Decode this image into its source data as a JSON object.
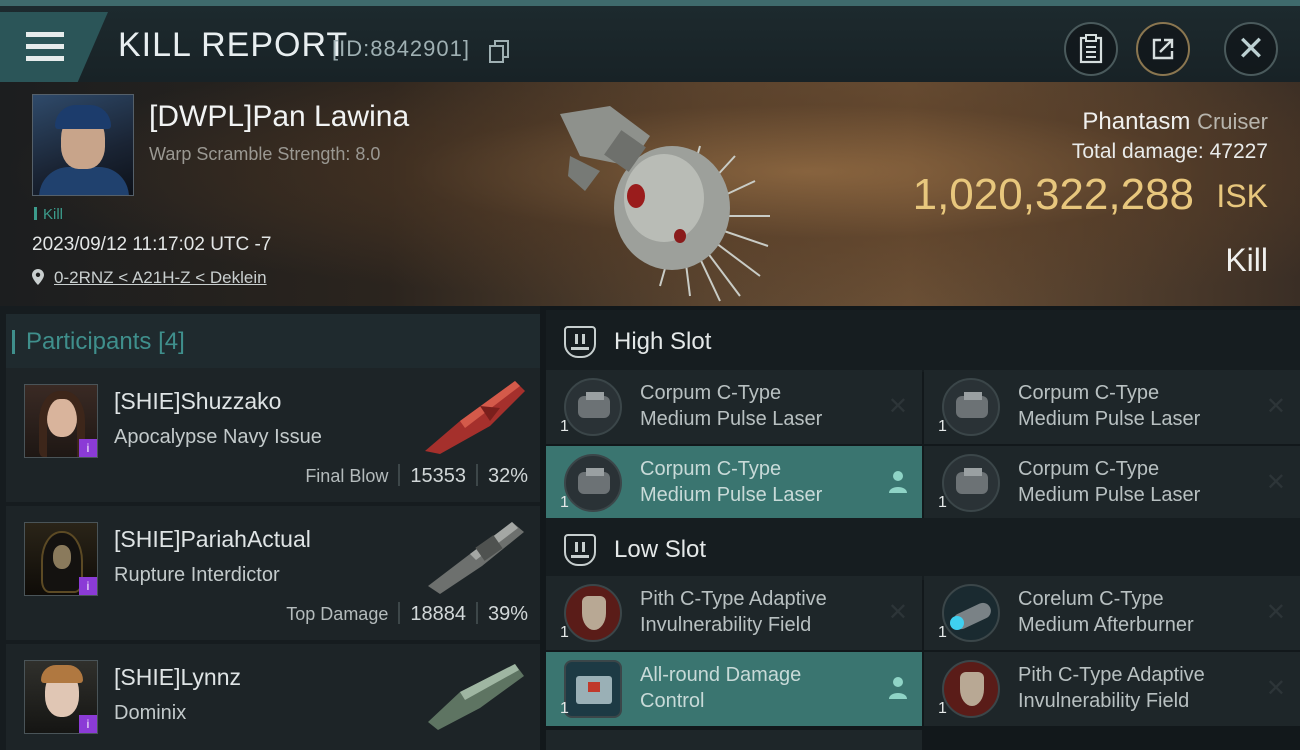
{
  "header": {
    "title": "KILL REPORT",
    "report_id": "[ID:8842901]"
  },
  "victim": {
    "name": "[DWPL]Pan Lawina",
    "scramble": "Warp Scramble Strength: 8.0",
    "tag": "Kill",
    "timestamp": "2023/09/12 11:17:02 UTC -7",
    "location": "0-2RNZ < A21H-Z < Deklein",
    "ship_name": "Phantasm",
    "ship_class": "Cruiser",
    "damage_label": "Total damage:",
    "damage_value": "47227",
    "isk_value": "1,020,322,288",
    "isk_unit": "ISK",
    "result": "Kill"
  },
  "participants": {
    "title": "Participants",
    "count": "[4]",
    "items": [
      {
        "name": "[SHIE]Shuzzako",
        "ship": "Apocalypse Navy Issue",
        "label": "Final Blow",
        "damage": "15353",
        "percent": "32%"
      },
      {
        "name": "[SHIE]PariahActual",
        "ship": "Rupture Interdictor",
        "label": "Top Damage",
        "damage": "18884",
        "percent": "39%"
      },
      {
        "name": "[SHIE]Lynnz",
        "ship": "Dominix",
        "label": "",
        "damage": "",
        "percent": ""
      }
    ]
  },
  "fitting": {
    "high_slot": {
      "title": "High Slot",
      "modules": [
        {
          "line1": "Corpum C-Type",
          "line2": "Medium Pulse Laser",
          "qty": "1"
        },
        {
          "line1": "Corpum C-Type",
          "line2": "Medium Pulse Laser",
          "qty": "1"
        },
        {
          "line1": "Corpum C-Type",
          "line2": "Medium Pulse Laser",
          "qty": "1"
        },
        {
          "line1": "Corpum C-Type",
          "line2": "Medium Pulse Laser",
          "qty": "1"
        }
      ]
    },
    "low_slot": {
      "title": "Low Slot",
      "modules": [
        {
          "line1": "Pith C-Type Adaptive",
          "line2": "Invulnerability Field",
          "qty": "1"
        },
        {
          "line1": "Corelum C-Type",
          "line2": "Medium Afterburner",
          "qty": "1"
        },
        {
          "line1": "All-round Damage",
          "line2": "Control",
          "qty": "1"
        },
        {
          "line1": "Pith C-Type Adaptive",
          "line2": "Invulnerability Field",
          "qty": "1"
        }
      ]
    }
  },
  "colors": {
    "accent_teal": "#3f8f8c",
    "isk_gold": "#e8c77d",
    "active_row": "#3a7570",
    "badge_purple": "#8b3bd6"
  }
}
